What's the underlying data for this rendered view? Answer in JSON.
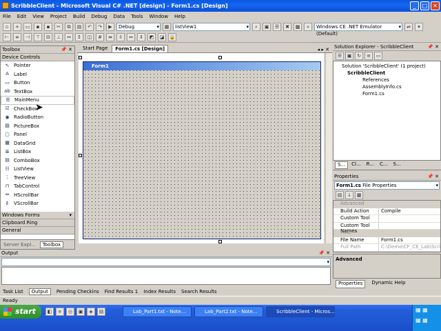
{
  "window": {
    "title": "ScribbleClient - Microsoft Visual C# .NET [design] - Form1.cs [Design]"
  },
  "menu": [
    "File",
    "Edit",
    "View",
    "Project",
    "Build",
    "Debug",
    "Data",
    "Tools",
    "Window",
    "Help"
  ],
  "toolbar": {
    "config": "Debug",
    "object": "listView1",
    "platform": "Windows CE .NET Emulator (Default)"
  },
  "toolbox": {
    "title": "Toolbox",
    "group": "Device Controls",
    "items": [
      "Pointer",
      "Label",
      "Button",
      "TextBox",
      "MainMenu",
      "CheckBox",
      "RadioButton",
      "PictureBox",
      "Panel",
      "DataGrid",
      "ListBox",
      "ComboBox",
      "ListView",
      "TreeView",
      "TabControl",
      "HScrollBar",
      "VScrollBar"
    ],
    "groups": [
      "Windows Forms",
      "Clipboard Ring",
      "General"
    ],
    "tabs": [
      "Server Expl...",
      "Toolbox"
    ]
  },
  "editor": {
    "tabs": [
      "Start Page",
      "Form1.cs [Design]"
    ],
    "form_title": "Form1"
  },
  "solution_explorer": {
    "title": "Solution Explorer - ScribbleClient",
    "nodes": [
      "Solution 'ScribbleClient' (1 project)",
      "ScribbleClient",
      "References",
      "AssemblyInfo.cs",
      "Form1.cs"
    ],
    "tabs": [
      "S...",
      "Cl...",
      "R...",
      "C...",
      "S..."
    ]
  },
  "properties": {
    "title": "Properties",
    "object": "Form1.cs",
    "object_type": "File Properties",
    "categories": [
      "Advanced",
      "Misc"
    ],
    "rows_advanced": [
      [
        "Build Action",
        "Compile"
      ],
      [
        "Custom Tool",
        ""
      ],
      [
        "Custom Tool Names",
        ""
      ]
    ],
    "rows_misc": [
      [
        "File Name",
        "Form1.cs"
      ],
      [
        "Full Path",
        "C:\\Demo\\CF_CE_Lab\\Scri"
      ]
    ],
    "description": "Advanced",
    "tabs": [
      "Properties",
      "Dynamic Help"
    ]
  },
  "output": {
    "title": "Output"
  },
  "bottom_tabs": [
    "Task List",
    "Output",
    "Pending Checkins",
    "Find Results 1",
    "Index Results",
    "Search Results"
  ],
  "status": "Ready",
  "taskbar": {
    "start": "start",
    "items": [
      "Lab_Part1.txt - Note...",
      "Lab_Part2.txt - Note...",
      "ScribbleClient - Micros..."
    ]
  }
}
